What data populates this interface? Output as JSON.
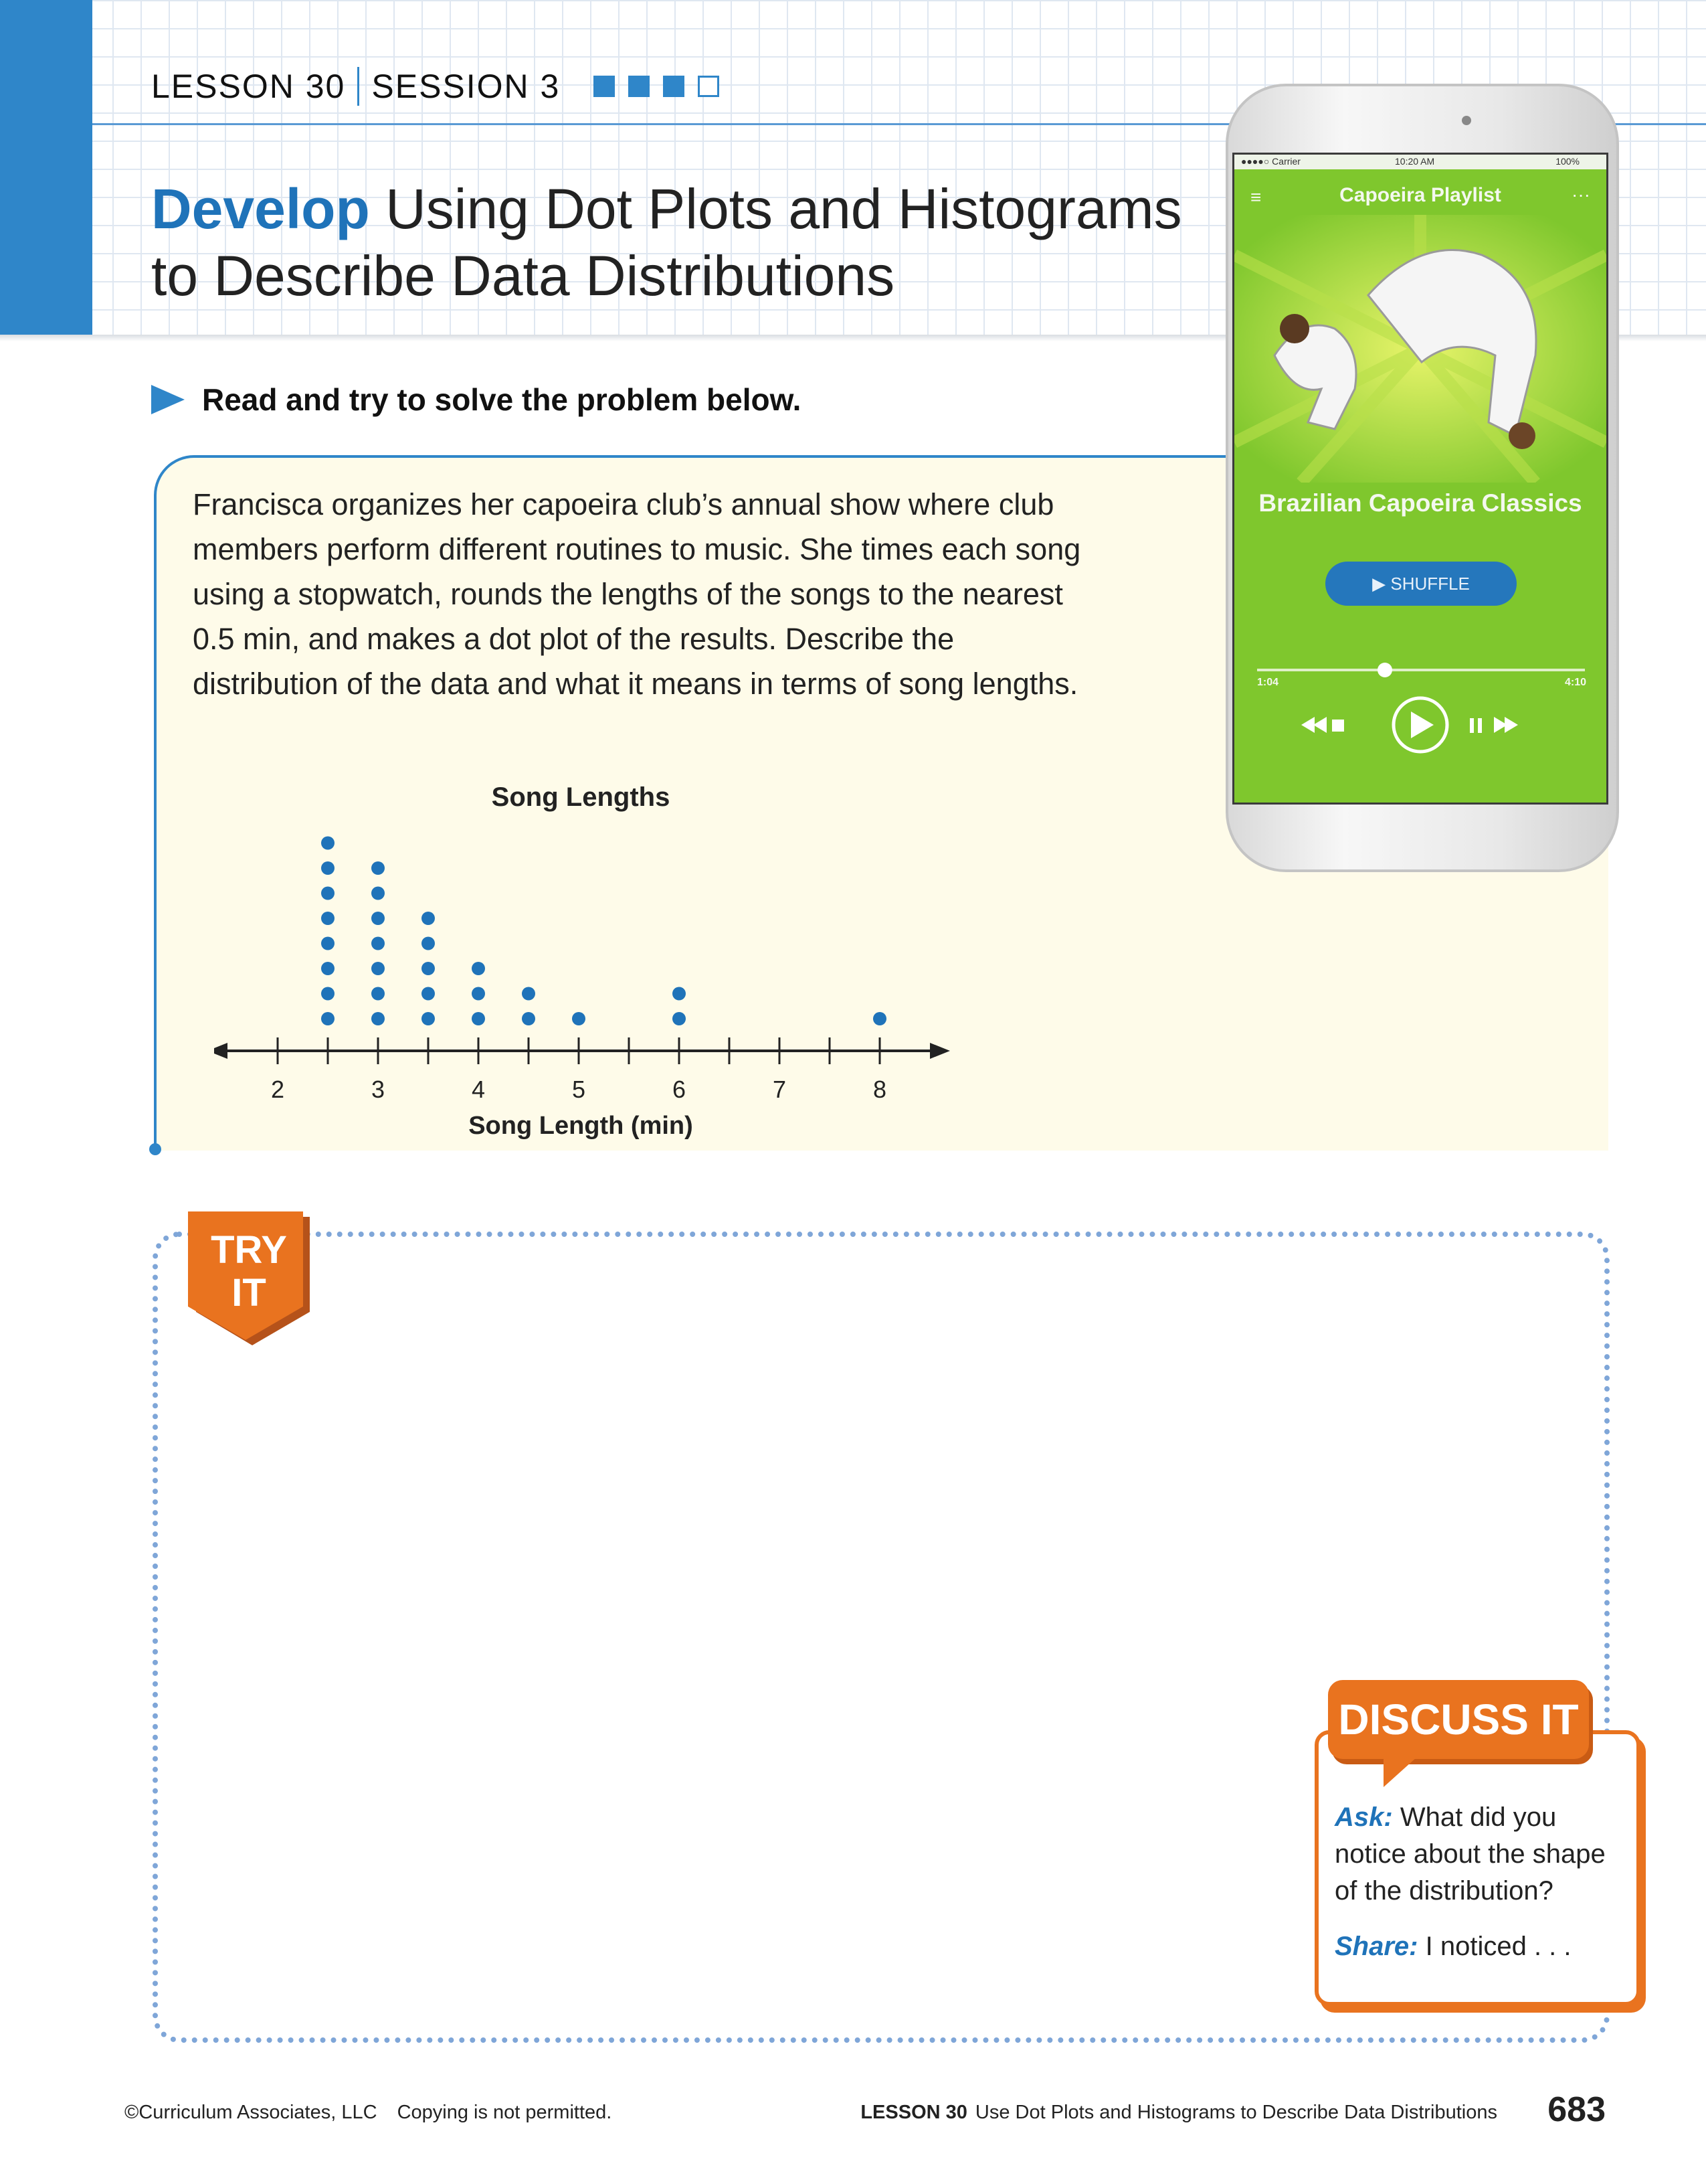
{
  "header": {
    "lesson": "LESSON 30",
    "session": "SESSION 3",
    "progress_squares": [
      true,
      true,
      true,
      false
    ],
    "title_bold": "Develop",
    "title_line1": " Using Dot Plots and Histograms",
    "title_line2": "to Describe Data Distributions"
  },
  "instruction": "Read and try to solve the problem below.",
  "problem": {
    "text": "Francisca organizes her capoeira club’s annual show where club members perform different routines to music. She times each song using a stopwatch, rounds the lengths of the songs to the nearest 0.5 min, and makes a dot plot of the results. Describe the distribution of the data and what it means in terms of song lengths."
  },
  "chart_data": {
    "type": "dot_plot",
    "title": "Song Lengths",
    "xlabel": "Song Length (min)",
    "x_ticks": [
      2,
      3,
      4,
      5,
      6,
      7,
      8
    ],
    "xlim": [
      1.5,
      8.5
    ],
    "points": [
      {
        "x": 2.5,
        "count": 8
      },
      {
        "x": 3,
        "count": 7
      },
      {
        "x": 3.5,
        "count": 5
      },
      {
        "x": 4,
        "count": 3
      },
      {
        "x": 4.5,
        "count": 2
      },
      {
        "x": 5,
        "count": 1
      },
      {
        "x": 6,
        "count": 2
      },
      {
        "x": 8,
        "count": 1
      }
    ],
    "dot_color": "#1f73b9"
  },
  "phone": {
    "carrier": "●●●●○ Carrier",
    "time": "10:20 AM",
    "battery": "100%",
    "playlist_title": "Capoeira Playlist",
    "album_title": "Brazilian Capoeira Classics",
    "shuffle_label": "▶ SHUFFLE",
    "elapsed": "1:04",
    "duration": "4:10",
    "screen_color": "#7fc72d"
  },
  "try_it": {
    "line1": "TRY",
    "line2": "IT"
  },
  "discuss": {
    "title": "DISCUSS IT",
    "ask_label": "Ask:",
    "ask_text": " What did you notice about the shape of the distribution?",
    "share_label": "Share:",
    "share_text": " I noticed . . ."
  },
  "footer": {
    "copyright": "©Curriculum Associates, LLC",
    "notice": "Copying is not permitted.",
    "lesson_label": "LESSON 30",
    "lesson_title": "Use Dot Plots and Histograms to Describe Data Distributions",
    "page_number": "683"
  },
  "colors": {
    "accent_blue": "#2f86c9",
    "accent_orange": "#e9731f"
  }
}
